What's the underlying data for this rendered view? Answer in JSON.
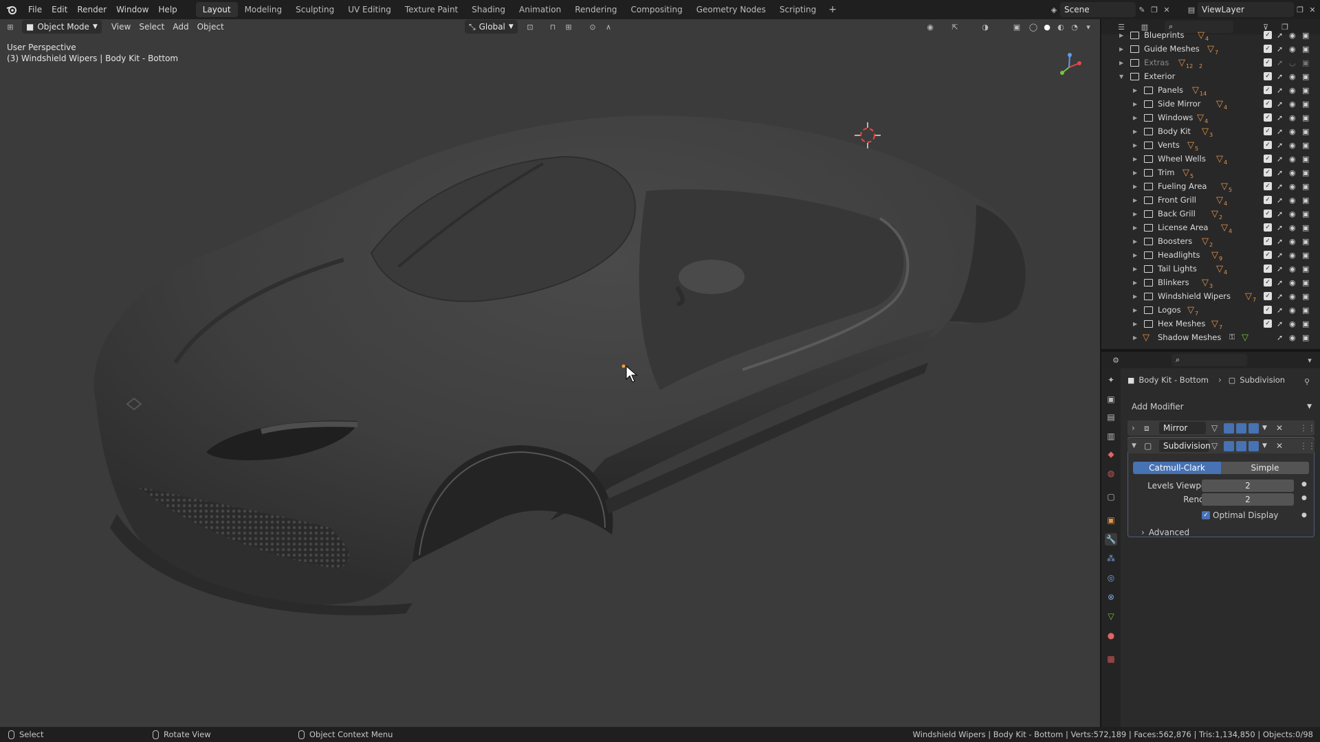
{
  "menu": {
    "file": "File",
    "edit": "Edit",
    "render": "Render",
    "window": "Window",
    "help": "Help"
  },
  "workspaces": [
    "Layout",
    "Modeling",
    "Sculpting",
    "UV Editing",
    "Texture Paint",
    "Shading",
    "Animation",
    "Rendering",
    "Compositing",
    "Geometry Nodes",
    "Scripting"
  ],
  "workspace_add": "+",
  "scene": {
    "name": "Scene"
  },
  "view_layer": {
    "name": "ViewLayer"
  },
  "viewport": {
    "mode": "Object Mode",
    "menu_view": "View",
    "menu_select": "Select",
    "menu_add": "Add",
    "menu_object": "Object",
    "transform_orientation": "Global",
    "perspective": "User Perspective",
    "active_object_info": "(3) Windshield Wipers | Body Kit - Bottom",
    "gizmo_axes": {
      "x": "X",
      "y": "Y",
      "z": "Z"
    }
  },
  "outliner": {
    "rows": [
      {
        "name": "Blueprints",
        "count": "4",
        "depth": 0,
        "expanded": false,
        "dim": false,
        "partial": true
      },
      {
        "name": "Guide Meshes",
        "count": "7",
        "depth": 0,
        "expanded": false,
        "dim": false
      },
      {
        "name": "Extras",
        "count": "12",
        "count2": "2",
        "depth": 0,
        "expanded": false,
        "dim": true
      },
      {
        "name": "Exterior",
        "count": "",
        "depth": 0,
        "expanded": true,
        "dim": false
      },
      {
        "name": "Panels",
        "count": "14",
        "depth": 1
      },
      {
        "name": "Side Mirror",
        "count": "4",
        "depth": 1
      },
      {
        "name": "Windows",
        "count": "4",
        "depth": 1
      },
      {
        "name": "Body Kit",
        "count": "3",
        "depth": 1
      },
      {
        "name": "Vents",
        "count": "5",
        "depth": 1
      },
      {
        "name": "Wheel Wells",
        "count": "4",
        "depth": 1
      },
      {
        "name": "Trim",
        "count": "5",
        "depth": 1
      },
      {
        "name": "Fueling Area",
        "count": "5",
        "depth": 1
      },
      {
        "name": "Front Grill",
        "count": "4",
        "depth": 1
      },
      {
        "name": "Back Grill",
        "count": "2",
        "depth": 1
      },
      {
        "name": "License Area",
        "count": "4",
        "depth": 1
      },
      {
        "name": "Boosters",
        "count": "2",
        "depth": 1
      },
      {
        "name": "Headlights",
        "count": "9",
        "depth": 1
      },
      {
        "name": "Tail Lights",
        "count": "4",
        "depth": 1
      },
      {
        "name": "Blinkers",
        "count": "3",
        "depth": 1
      },
      {
        "name": "Windshield Wipers",
        "count": "7",
        "depth": 1
      },
      {
        "name": "Logos",
        "count": "7",
        "depth": 1
      },
      {
        "name": "Hex Meshes",
        "count": "7",
        "depth": 1
      },
      {
        "name": "Shadow Meshes",
        "count": "",
        "depth": 1,
        "mesh_object": true
      }
    ]
  },
  "properties": {
    "breadcrumb_object": "Body Kit - Bottom",
    "breadcrumb_modifier": "Subdivision",
    "add_modifier": "Add Modifier",
    "modifiers": [
      {
        "name": "Mirror",
        "expanded": false
      },
      {
        "name": "Subdivision",
        "expanded": true
      }
    ],
    "subdivision": {
      "method_catmull": "Catmull-Clark",
      "method_simple": "Simple",
      "levels_viewport_label": "Levels Viewport",
      "levels_viewport_value": "2",
      "render_label": "Render",
      "render_value": "2",
      "optimal_display_label": "Optimal Display",
      "optimal_display_checked": true,
      "advanced_label": "Advanced"
    }
  },
  "status": {
    "select": "Select",
    "rotate_view": "Rotate View",
    "context_menu": "Object Context Menu",
    "stats": "Windshield Wipers | Body Kit - Bottom | Verts:572,189 | Faces:562,876 | Tris:1,134,850 | Objects:0/98"
  },
  "colors": {
    "accent": "#4772b3",
    "viewport_bg": "#3b3b3b",
    "mesh_icon": "#e5954c",
    "panel_bg": "#2b2b2b"
  }
}
